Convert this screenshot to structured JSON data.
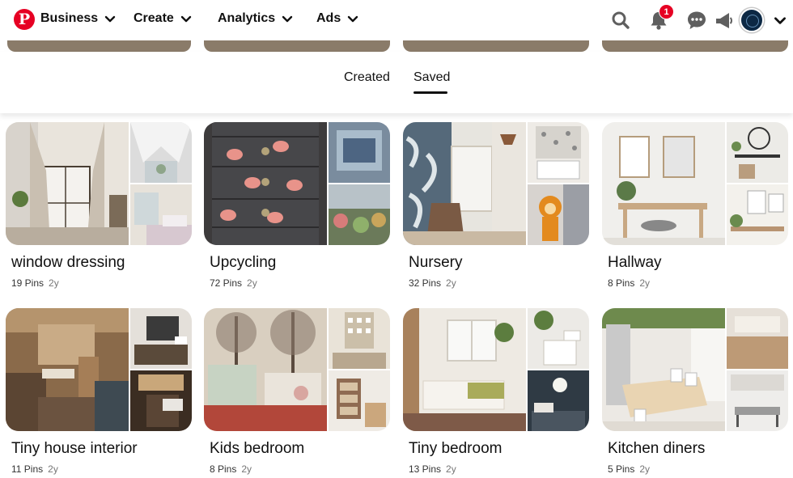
{
  "header": {
    "logo": "P",
    "nav": [
      {
        "label": "Business"
      },
      {
        "label": "Create"
      },
      {
        "label": "Analytics"
      },
      {
        "label": "Ads"
      }
    ],
    "notification_count": "1",
    "icons": [
      "search-icon",
      "bell-icon",
      "chat-icon",
      "megaphone-icon",
      "avatar",
      "chevron-down-icon"
    ]
  },
  "tabs": {
    "created": "Created",
    "saved": "Saved",
    "active": "Saved"
  },
  "boards": [
    {
      "name": "window dressing",
      "pins": "19 Pins",
      "age": "2y"
    },
    {
      "name": "Upcycling",
      "pins": "72 Pins",
      "age": "2y"
    },
    {
      "name": "Nursery",
      "pins": "32 Pins",
      "age": "2y"
    },
    {
      "name": "Hallway",
      "pins": "8 Pins",
      "age": "2y"
    },
    {
      "name": "Tiny house interior",
      "pins": "11 Pins",
      "age": "2y"
    },
    {
      "name": "Kids bedroom",
      "pins": "8 Pins",
      "age": "2y"
    },
    {
      "name": "Tiny bedroom",
      "pins": "13 Pins",
      "age": "2y"
    },
    {
      "name": "Kitchen diners",
      "pins": "5 Pins",
      "age": "2y"
    }
  ],
  "colors": {
    "brand": "#e60023",
    "text": "#111111",
    "muted": "#767676"
  }
}
